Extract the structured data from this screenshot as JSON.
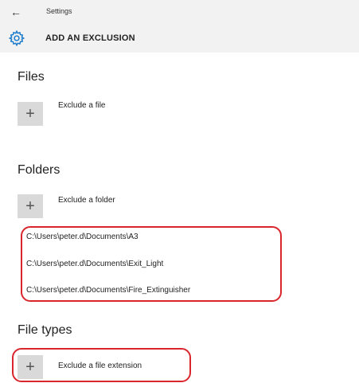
{
  "titlebar": {
    "back_icon": "arrow-left-icon",
    "app_title": "Settings"
  },
  "header": {
    "icon": "gear-icon",
    "title": "ADD AN EXCLUSION"
  },
  "files": {
    "heading": "Files",
    "add_icon": "plus-icon",
    "add_label": "Exclude a file"
  },
  "folders": {
    "heading": "Folders",
    "add_icon": "plus-icon",
    "add_label": "Exclude a folder",
    "items": [
      "C:\\Users\\peter.d\\Documents\\A3",
      "C:\\Users\\peter.d\\Documents\\Exit_Light",
      "C:\\Users\\peter.d\\Documents\\Fire_Extinguisher"
    ]
  },
  "file_types": {
    "heading": "File types",
    "add_icon": "plus-icon",
    "add_label": "Exclude a file extension"
  },
  "colors": {
    "header_bg": "#f2f2f2",
    "accent": "#1979ca",
    "button_bg": "#d9d9d9",
    "highlight": "#d9262c"
  }
}
